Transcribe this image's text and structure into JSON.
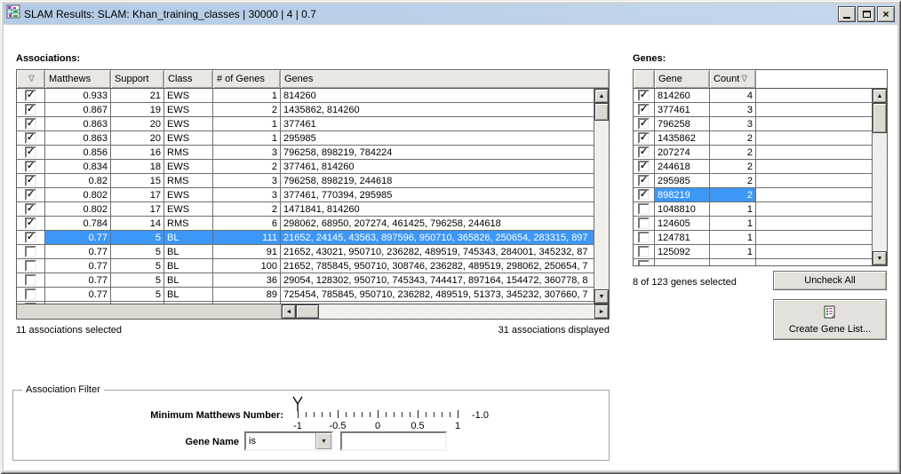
{
  "window": {
    "title": "SLAM Results: SLAM: Khan_training_classes | 30000 | 4 | 0.7"
  },
  "icons": {
    "check": "✓",
    "sort_desc": "∇",
    "up": "▲",
    "down": "▼",
    "left": "◄",
    "right": "►",
    "dropdown": "▼",
    "close": "×"
  },
  "associations": {
    "label": "Associations:",
    "columns": [
      "",
      "Matthews",
      "Support",
      "Class",
      "# of Genes",
      "Genes"
    ],
    "rows": [
      {
        "checked": true,
        "selected": false,
        "matthews": "0.933",
        "support": "21",
        "class": "EWS",
        "num_genes": "1",
        "genes": "814260"
      },
      {
        "checked": true,
        "selected": false,
        "matthews": "0.867",
        "support": "19",
        "class": "EWS",
        "num_genes": "2",
        "genes": "1435862, 814260"
      },
      {
        "checked": true,
        "selected": false,
        "matthews": "0.863",
        "support": "20",
        "class": "EWS",
        "num_genes": "1",
        "genes": "377461"
      },
      {
        "checked": true,
        "selected": false,
        "matthews": "0.863",
        "support": "20",
        "class": "EWS",
        "num_genes": "1",
        "genes": "295985"
      },
      {
        "checked": true,
        "selected": false,
        "matthews": "0.856",
        "support": "16",
        "class": "RMS",
        "num_genes": "3",
        "genes": "796258, 898219, 784224"
      },
      {
        "checked": true,
        "selected": false,
        "matthews": "0.834",
        "support": "18",
        "class": "EWS",
        "num_genes": "2",
        "genes": "377461, 814260"
      },
      {
        "checked": true,
        "selected": false,
        "matthews": "0.82",
        "support": "15",
        "class": "RMS",
        "num_genes": "3",
        "genes": "796258, 898219, 244618"
      },
      {
        "checked": true,
        "selected": false,
        "matthews": "0.802",
        "support": "17",
        "class": "EWS",
        "num_genes": "3",
        "genes": "377461, 770394, 295985"
      },
      {
        "checked": true,
        "selected": false,
        "matthews": "0.802",
        "support": "17",
        "class": "EWS",
        "num_genes": "2",
        "genes": "1471841, 814260"
      },
      {
        "checked": true,
        "selected": false,
        "matthews": "0.784",
        "support": "14",
        "class": "RMS",
        "num_genes": "6",
        "genes": "298062, 68950, 207274, 461425, 796258, 244618"
      },
      {
        "checked": true,
        "selected": true,
        "matthews": "0.77",
        "support": "5",
        "class": "BL",
        "num_genes": "111",
        "genes": "21652, 24145, 43563, 897596, 950710, 365826, 250654, 283315, 897"
      },
      {
        "checked": false,
        "selected": false,
        "matthews": "0.77",
        "support": "5",
        "class": "BL",
        "num_genes": "91",
        "genes": "21652, 43021, 950710, 236282, 489519, 745343, 284001, 345232, 87"
      },
      {
        "checked": false,
        "selected": false,
        "matthews": "0.77",
        "support": "5",
        "class": "BL",
        "num_genes": "100",
        "genes": "21652, 785845, 950710, 308746, 236282, 489519, 298062, 250654, 7"
      },
      {
        "checked": false,
        "selected": false,
        "matthews": "0.77",
        "support": "5",
        "class": "BL",
        "num_genes": "36",
        "genes": "29054, 128302, 950710, 745343, 744417, 897164, 154472, 360778, 8"
      },
      {
        "checked": false,
        "selected": false,
        "matthews": "0.77",
        "support": "5",
        "class": "BL",
        "num_genes": "89",
        "genes": "725454, 785845, 950710, 236282, 489519, 51373, 345232, 307660, 7"
      },
      {
        "checked": false,
        "selected": false,
        "matthews": "",
        "support": "",
        "class": "",
        "num_genes": "",
        "genes": "",
        "partial": true
      }
    ],
    "selected_text": "11 associations selected",
    "displayed_text": "31 associations displayed"
  },
  "genes": {
    "label": "Genes:",
    "columns": [
      "",
      "Gene",
      "Count"
    ],
    "rows": [
      {
        "checked": true,
        "selected": false,
        "gene": "814260",
        "count": "4"
      },
      {
        "checked": true,
        "selected": false,
        "gene": "377461",
        "count": "3"
      },
      {
        "checked": true,
        "selected": false,
        "gene": "796258",
        "count": "3"
      },
      {
        "checked": true,
        "selected": false,
        "gene": "1435862",
        "count": "2"
      },
      {
        "checked": true,
        "selected": false,
        "gene": "207274",
        "count": "2"
      },
      {
        "checked": true,
        "selected": false,
        "gene": "244618",
        "count": "2"
      },
      {
        "checked": true,
        "selected": false,
        "gene": "295985",
        "count": "2"
      },
      {
        "checked": true,
        "selected": true,
        "gene": "898219",
        "count": "2"
      },
      {
        "checked": false,
        "selected": false,
        "gene": "1048810",
        "count": "1"
      },
      {
        "checked": false,
        "selected": false,
        "gene": "124605",
        "count": "1"
      },
      {
        "checked": false,
        "selected": false,
        "gene": "124781",
        "count": "1"
      },
      {
        "checked": false,
        "selected": false,
        "gene": "125092",
        "count": "1"
      },
      {
        "checked": false,
        "selected": false,
        "gene": "",
        "count": "",
        "partial": true
      }
    ],
    "selected_text": "8 of 123 genes selected",
    "uncheck_all_label": "Uncheck All",
    "create_gene_list_label": "Create Gene List..."
  },
  "filter": {
    "title": "Association Filter",
    "matthews_label": "Minimum Matthews Number:",
    "slider_ticks": [
      "-1",
      "-0.5",
      "0",
      "0.5",
      "1"
    ],
    "slider_value": "-1.0",
    "gene_name_label": "Gene Name",
    "gene_name_operator": "is",
    "gene_name_value": ""
  }
}
